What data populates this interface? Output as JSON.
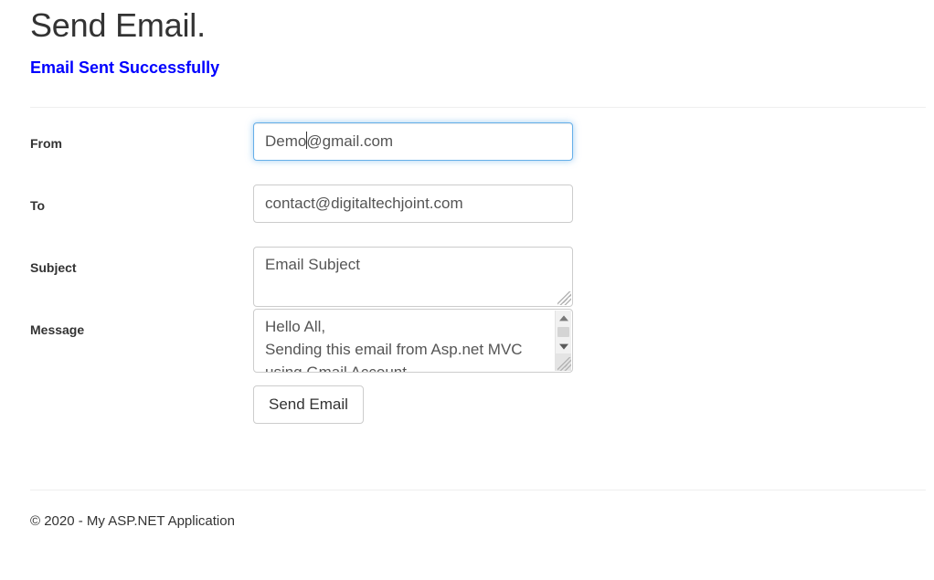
{
  "page": {
    "title": "Send Email.",
    "status_message": "Email Sent Successfully",
    "status_color": "#0000ff"
  },
  "form": {
    "fields": [
      {
        "label": "From",
        "type": "input",
        "value": "Demo@gmail.com",
        "value_before_caret": "Demo",
        "value_after_caret": "@gmail.com",
        "focused": true
      },
      {
        "label": "To",
        "type": "input",
        "value": "contact@digitaltechjoint.com",
        "focused": false
      },
      {
        "label": "Subject",
        "type": "textarea",
        "value": "Email Subject",
        "focused": false
      },
      {
        "label": "Message",
        "type": "textarea",
        "value": "Hello All,\nSending this email from Asp.net MVC using Gmail Account",
        "lines": [
          "Hello All,",
          "Sending this email from Asp.net MVC",
          "using Gmail Account"
        ],
        "focused": false,
        "has_scrollbar": true
      }
    ],
    "submit_label": "Send Email"
  },
  "footer": {
    "text": "© 2020 - My ASP.NET Application"
  }
}
